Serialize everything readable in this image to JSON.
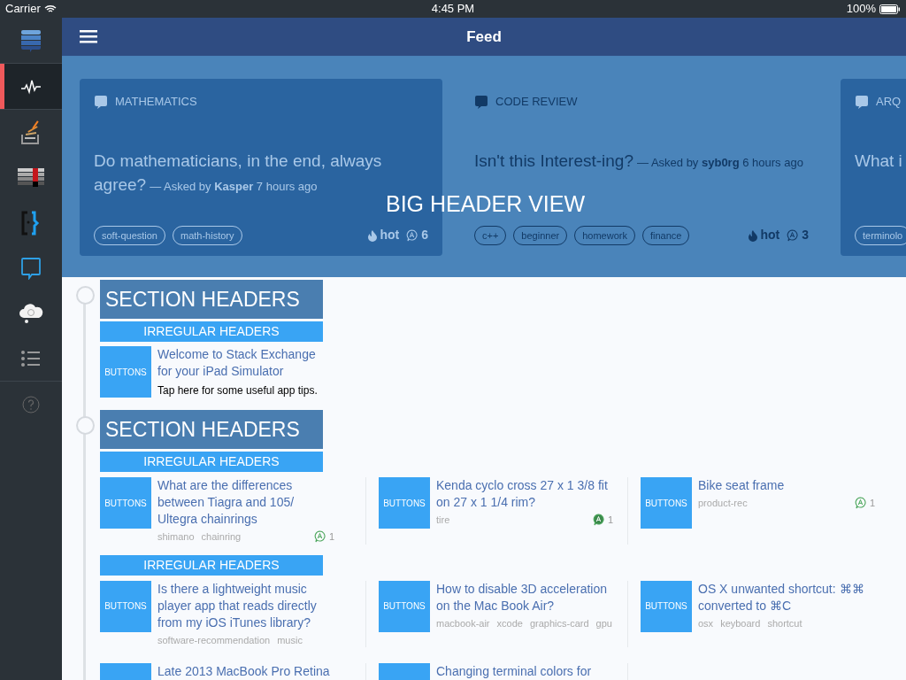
{
  "status_bar": {
    "carrier": "Carrier",
    "time": "4:45 PM",
    "battery": "100%"
  },
  "sidebar": {
    "items": [
      {
        "selected": false
      },
      {
        "selected": true
      },
      {
        "selected": false
      },
      {
        "selected": false
      },
      {
        "selected": false
      },
      {
        "selected": false
      },
      {
        "selected": false
      },
      {
        "selected": false
      },
      {
        "selected": false
      }
    ]
  },
  "nav_bar": {
    "title": "Feed"
  },
  "header": {
    "overlay_title": "BIG HEADER VIEW",
    "cards": [
      {
        "site": "MATHEMATICS",
        "title": "Do mathematicians, in the end, always agree?",
        "byline": "— Asked by **Kasper** 7 hours ago",
        "tags": [
          "soft-question",
          "math-history"
        ],
        "hot": "hot",
        "answers": "6",
        "kind": "card"
      },
      {
        "site": "CODE REVIEW",
        "title": "Isn't this Interest-ing?",
        "byline": "— Asked by **syb0rg** 6 hours ago",
        "tags": [
          "c++",
          "beginner",
          "homework",
          "finance"
        ],
        "hot": "hot",
        "answers": "3",
        "kind": "plain"
      },
      {
        "site": "ARQ",
        "title": "What i",
        "tags": [
          "terminolo"
        ],
        "kind": "card"
      }
    ]
  },
  "sections": [
    {
      "header": "SECTION HEADERS",
      "groups": [
        {
          "header": "IRREGULAR HEADERS",
          "kind": "welcome",
          "items": [
            {
              "button": "BUTTONS",
              "title": "Welcome to Stack Exchange for your iPad Simulator",
              "subtitle": "Tap here for some useful app tips."
            }
          ]
        }
      ]
    },
    {
      "header": "SECTION HEADERS",
      "groups": [
        {
          "header": "IRREGULAR HEADERS",
          "kind": "questions",
          "items": [
            {
              "button": "BUTTONS",
              "title": "What are the differences between Tiagra and 105/ Ultegra chainrings",
              "tags": [
                "shimano",
                "chainring"
              ],
              "answers": "1",
              "accepted": false
            },
            {
              "button": "BUTTONS",
              "title": "Kenda cyclo cross 27 x 1 3/8 fit on 27 x 1 1/4 rim?",
              "tags": [
                "tire"
              ],
              "answers": "1",
              "accepted": true
            },
            {
              "button": "BUTTONS",
              "title": "Bike seat frame",
              "tags": [
                "product-rec"
              ],
              "answers": "1",
              "accepted": false
            }
          ]
        },
        {
          "header": "IRREGULAR HEADERS",
          "kind": "questions",
          "items": [
            {
              "button": "BUTTONS",
              "title": "Is there a lightweight music player app that reads directly from my iOS iTunes library?",
              "tags": [
                "software-recommendation",
                "music"
              ]
            },
            {
              "button": "BUTTONS",
              "title": "How to disable 3D acceleration on the Mac Book Air?",
              "tags": [
                "macbook-air",
                "xcode",
                "graphics-card",
                "gpu"
              ]
            },
            {
              "button": "BUTTONS",
              "title": "OS X unwanted shortcut: ⌘⌘ converted to ⌘C",
              "tags": [
                "osx",
                "keyboard",
                "shortcut"
              ]
            },
            {
              "title": "Late 2013 MacBook Pro Retina"
            },
            {
              "title": "Changing terminal colors for"
            }
          ]
        }
      ]
    }
  ]
}
